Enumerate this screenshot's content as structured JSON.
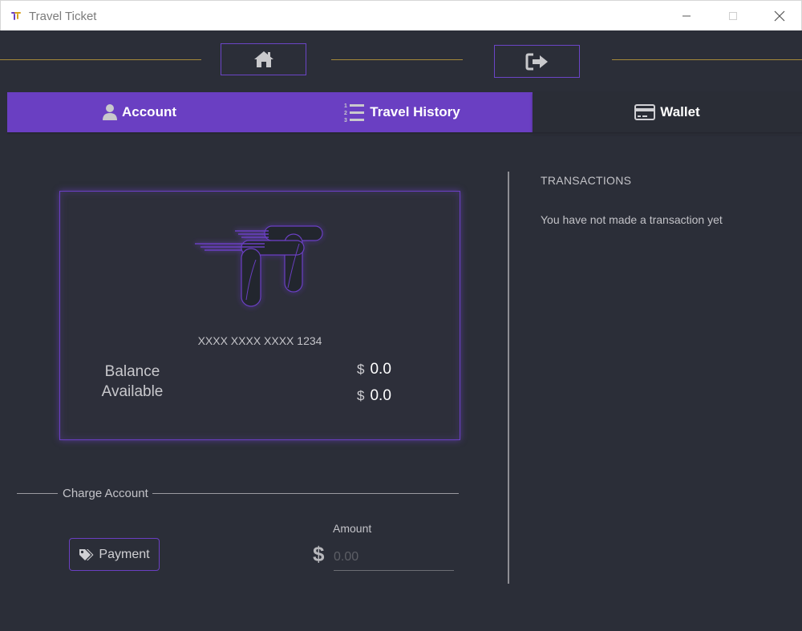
{
  "window": {
    "title": "Travel Ticket",
    "minimize_icon": "minimize-icon",
    "maximize_icon": "maximize-icon",
    "close_icon": "close-icon"
  },
  "nav": {
    "home_icon": "home-icon",
    "logout_icon": "sign-out-icon"
  },
  "tabs": [
    {
      "label": "Account",
      "icon": "user-icon",
      "active": true
    },
    {
      "label": "Travel History",
      "icon": "numbered-list-icon",
      "active": true
    },
    {
      "label": "Wallet",
      "icon": "credit-card-icon",
      "active": false
    }
  ],
  "card": {
    "number": "XXXX XXXX XXXX 1234",
    "balance_label_line1": "Balance",
    "balance_label_line2": "Available",
    "currency_symbol": "$",
    "balance": "0.0",
    "available": "0.0"
  },
  "charge": {
    "section_title": "Charge Account",
    "payment_label": "Payment",
    "payment_icon": "tags-icon",
    "amount_label": "Amount",
    "amount_currency": "$",
    "amount_placeholder": "0.00",
    "amount_value": ""
  },
  "transactions": {
    "title": "TRANSACTIONS",
    "empty_message": "You have not made a transaction yet"
  },
  "colors": {
    "accent": "#6a3fc2",
    "background": "#2b2e38",
    "gold_line": "#a68a3a"
  }
}
